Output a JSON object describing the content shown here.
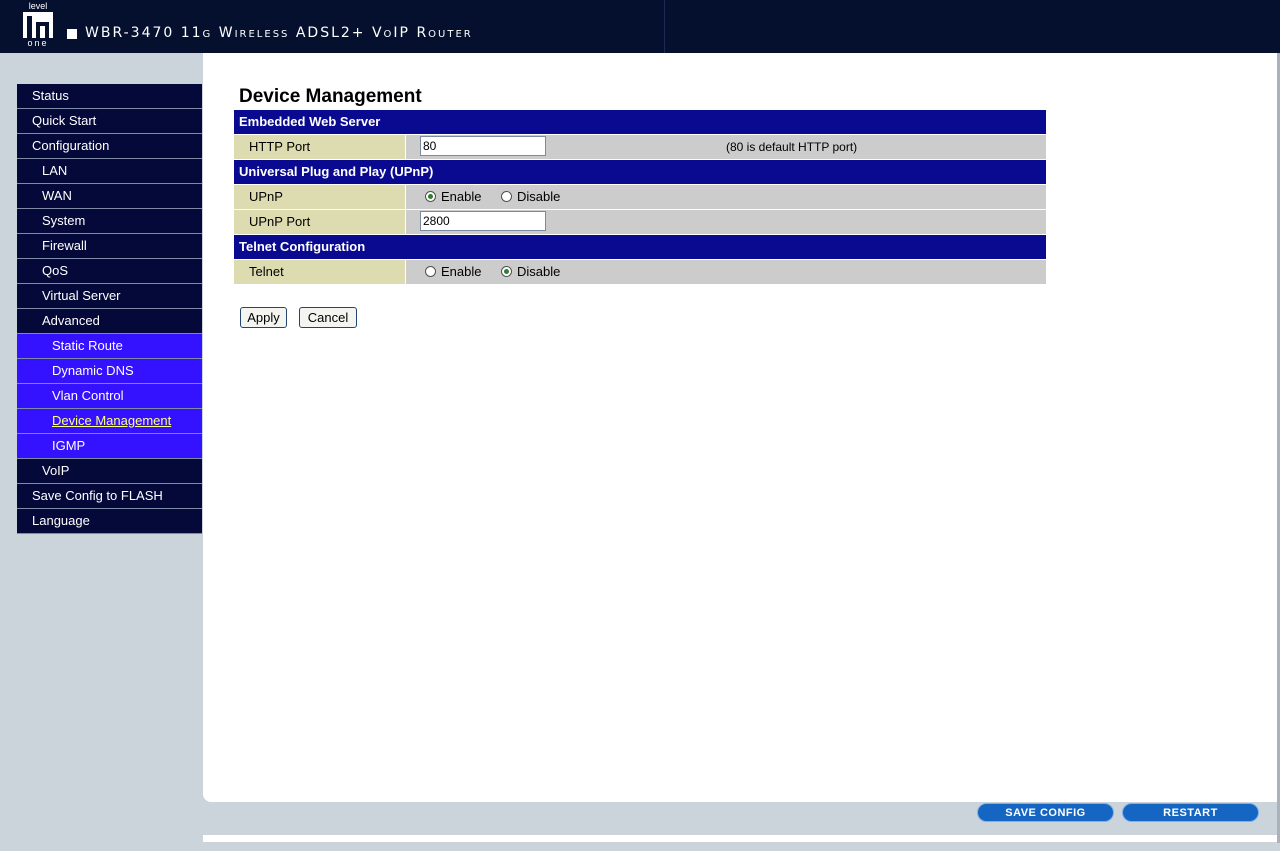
{
  "header": {
    "logo_top": "level",
    "logo_bottom": "one",
    "title": "WBR-3470 11g Wireless ADSL2+ VoIP Router"
  },
  "sidebar": {
    "items": [
      {
        "label": "Status",
        "level": 1
      },
      {
        "label": "Quick Start",
        "level": 1
      },
      {
        "label": "Configuration",
        "level": 1
      },
      {
        "label": "LAN",
        "level": 2
      },
      {
        "label": "WAN",
        "level": 2
      },
      {
        "label": "System",
        "level": 2
      },
      {
        "label": "Firewall",
        "level": 2
      },
      {
        "label": "QoS",
        "level": 2
      },
      {
        "label": "Virtual Server",
        "level": 2
      },
      {
        "label": "Advanced",
        "level": 2
      },
      {
        "label": "Static Route",
        "level": 3
      },
      {
        "label": "Dynamic DNS",
        "level": 3
      },
      {
        "label": "Vlan Control",
        "level": 3
      },
      {
        "label": "Device Management",
        "level": 3,
        "active": true
      },
      {
        "label": "IGMP",
        "level": 3
      },
      {
        "label": "VoIP",
        "level": 2
      },
      {
        "label": "Save Config to FLASH",
        "level": 1
      },
      {
        "label": "Language",
        "level": 1
      }
    ]
  },
  "page": {
    "title": "Device Management",
    "web_server": {
      "heading": "Embedded Web Server",
      "http_port_label": "HTTP Port",
      "http_port_value": "80",
      "http_port_note": "(80 is default HTTP port)"
    },
    "upnp": {
      "heading": "Universal Plug and Play (UPnP)",
      "upnp_label": "UPnP",
      "enable_label": "Enable",
      "disable_label": "Disable",
      "selected": "enable",
      "port_label": "UPnP Port",
      "port_value": "2800"
    },
    "telnet": {
      "heading": "Telnet Configuration",
      "telnet_label": "Telnet",
      "enable_label": "Enable",
      "disable_label": "Disable",
      "selected": "disable"
    },
    "buttons": {
      "apply": "Apply",
      "cancel": "Cancel"
    }
  },
  "footer": {
    "save_config": "SAVE CONFIG",
    "restart": "RESTART"
  }
}
